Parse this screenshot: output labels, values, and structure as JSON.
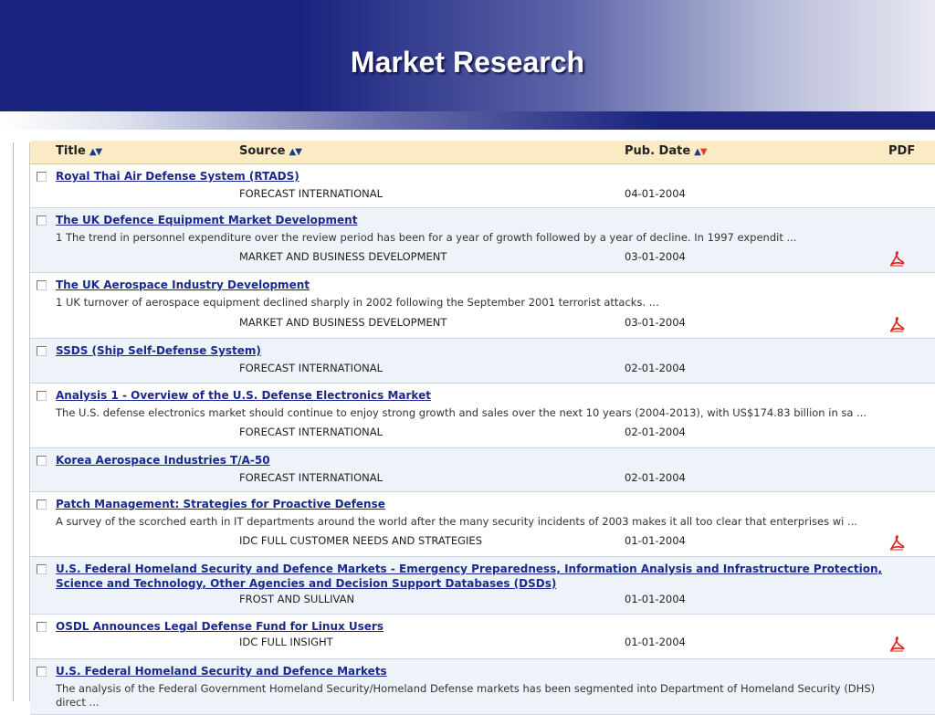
{
  "page": {
    "title": "Market Research"
  },
  "columns": {
    "title": "Title",
    "source": "Source",
    "pub_date": "Pub. Date",
    "pdf": "PDF"
  },
  "icons": {
    "sort_up": "triangle-up",
    "sort_down": "triangle-down",
    "pdf": "adobe-pdf-icon",
    "checkbox": "checkbox"
  },
  "colors": {
    "banner_blue": "#1a237e",
    "header_bg": "#fbebc4",
    "link_blue": "#1a2a8c",
    "row_alt": "#eef3fa",
    "pdf_red": "#e0201a",
    "active_sort": "#e04020"
  },
  "rows": [
    {
      "title": "Royal Thai Air Defense System (RTADS)",
      "source": "FORECAST INTERNATIONAL",
      "date": "04-01-2004",
      "pdf": false
    },
    {
      "title": "The UK Defence Equipment Market Development",
      "desc": "1 The trend in personnel expenditure over the review period has been for a year of growth followed by a year of decline. In 1997 expendit ...",
      "source": "MARKET AND BUSINESS DEVELOPMENT",
      "date": "03-01-2004",
      "pdf": true
    },
    {
      "title": "The UK Aerospace Industry Development",
      "desc": "1 UK turnover of aerospace equipment declined sharply in 2002 following the September 2001 terrorist attacks. ...",
      "source": "MARKET AND BUSINESS DEVELOPMENT",
      "date": "03-01-2004",
      "pdf": true
    },
    {
      "title": "SSDS (Ship Self-Defense System)",
      "source": "FORECAST INTERNATIONAL",
      "date": "02-01-2004",
      "pdf": false
    },
    {
      "title": "Analysis 1 - Overview of the U.S. Defense Electronics Market",
      "desc": "The U.S. defense electronics market should continue to enjoy strong growth and sales over the next 10 years (2004-2013), with US$174.83 billion in sa ...",
      "source": "FORECAST INTERNATIONAL",
      "date": "02-01-2004",
      "pdf": false
    },
    {
      "title": "Korea Aerospace Industries T/A-50",
      "source": "FORECAST INTERNATIONAL",
      "date": "02-01-2004",
      "pdf": false
    },
    {
      "title": "Patch Management: Strategies for Proactive Defense",
      "desc": "A survey of the scorched earth in IT departments around the world after the many security incidents of 2003 makes it all too clear that enterprises wi ...",
      "source": "IDC FULL CUSTOMER NEEDS AND STRATEGIES",
      "date": "01-01-2004",
      "pdf": true
    },
    {
      "title": "U.S. Federal Homeland Security and Defence Markets - Emergency Preparedness, Information Analysis and Infrastructure Protection,",
      "title2": "Science and Technology, Other Agencies and Decision Support Databases (DSDs)",
      "source": "FROST AND SULLIVAN",
      "date": "01-01-2004",
      "pdf": false
    },
    {
      "title": "OSDL Announces Legal Defense Fund for Linux Users",
      "source": "IDC FULL INSIGHT",
      "date": "01-01-2004",
      "pdf": true
    },
    {
      "title": "U.S. Federal Homeland Security and Defence Markets",
      "desc": "The analysis of the Federal Government Homeland Security/Homeland Defense markets has been segmented into Department of Homeland Security (DHS)",
      "desc2": "direct ...",
      "pdf": false
    }
  ]
}
